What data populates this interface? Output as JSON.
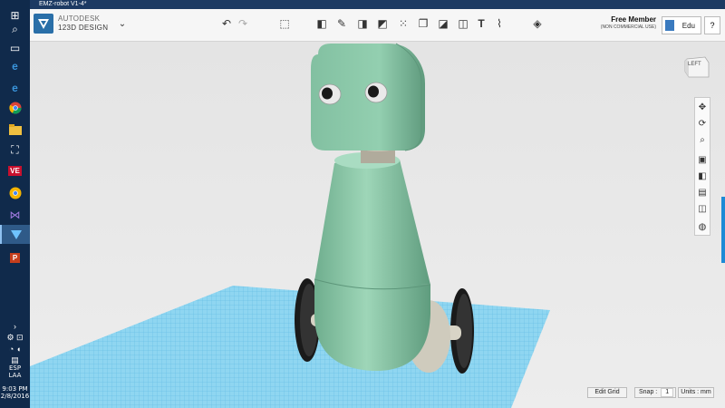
{
  "window": {
    "title": "EMZ-robot V1-4*"
  },
  "brand": {
    "company": "AUTODESK",
    "product": "123D DESIGN"
  },
  "toolbar": {
    "tools": [
      {
        "name": "undo-icon",
        "glyph": "↶"
      },
      {
        "name": "redo-icon",
        "glyph": "↷"
      },
      {
        "name": "add-shape-icon",
        "glyph": "⬛"
      },
      {
        "name": "primitives-icon",
        "glyph": "◧"
      },
      {
        "name": "sketch-icon",
        "glyph": "✎"
      },
      {
        "name": "construct-icon",
        "glyph": "◨"
      },
      {
        "name": "modify-icon",
        "glyph": "◩"
      },
      {
        "name": "pattern-icon",
        "glyph": "⁙"
      },
      {
        "name": "group-icon",
        "glyph": "❐"
      },
      {
        "name": "combine-icon",
        "glyph": "◪"
      },
      {
        "name": "text-icon",
        "glyph": "T"
      },
      {
        "name": "snap-icon",
        "glyph": "⌇"
      },
      {
        "name": "materials-icon",
        "glyph": "◈"
      }
    ]
  },
  "account": {
    "member": "Free Member",
    "license": "(NON COMMERCIAL USE)",
    "user": "Edu",
    "help": "?"
  },
  "viewcube": {
    "face": "LEFT"
  },
  "navigation": {
    "items": [
      {
        "name": "pan-icon",
        "glyph": "✥"
      },
      {
        "name": "orbit-icon",
        "glyph": "⟳"
      },
      {
        "name": "zoom-icon",
        "glyph": "⌕"
      },
      {
        "name": "fit-icon",
        "glyph": "▣"
      },
      {
        "name": "view-icon",
        "glyph": "◧"
      },
      {
        "name": "ortho-icon",
        "glyph": "▤"
      },
      {
        "name": "visibility-icon",
        "glyph": "◫"
      },
      {
        "name": "material-icon",
        "glyph": "◍"
      }
    ]
  },
  "status": {
    "edit_grid": "Edit Grid",
    "snap_label": "Snap :",
    "snap_value": "1",
    "units": "Units : mm"
  },
  "taskbar": {
    "lang1": "ESP",
    "lang2": "LAA",
    "time": "9:03 PM",
    "date": "2/8/2016"
  },
  "colors": {
    "robot_body": "#8ccaa8",
    "grid": "#6ac4e8",
    "accent": "#1e8ad6"
  }
}
